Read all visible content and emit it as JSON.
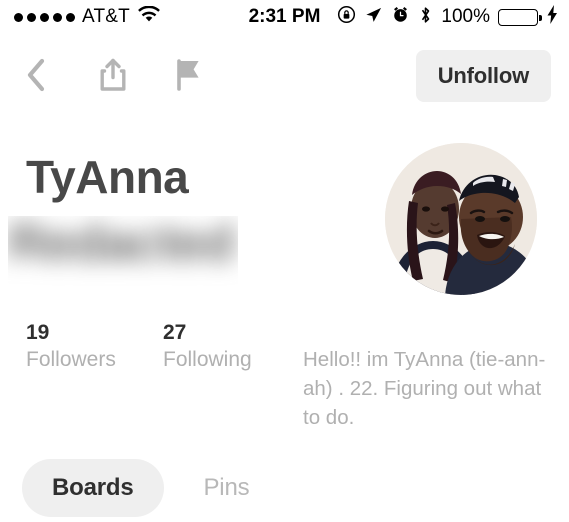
{
  "status_bar": {
    "signal_dots": 5,
    "carrier": "AT&T",
    "wifi_icon": "wifi-icon",
    "time": "2:31 PM",
    "rotation_lock_icon": "rotation-lock-icon",
    "location_icon": "location-arrow-icon",
    "alarm_icon": "alarm-clock-icon",
    "bluetooth_icon": "bluetooth-icon",
    "battery_percent": "100%",
    "battery_fill_color": "#4CD964",
    "charging_icon": "lightning-bolt-icon"
  },
  "navbar": {
    "back_icon": "back-chevron-icon",
    "share_icon": "share-icon",
    "flag_icon": "flag-icon",
    "unfollow_label": "Unfollow",
    "icon_color": "#b4b4b4",
    "button_bg": "#efefef"
  },
  "profile": {
    "name": "TyAnna",
    "last_name_redacted": "Redacted",
    "avatar_alt": "profile-photo-two-people",
    "bio": "Hello!! im TyAnna (tie-ann-ah) . 22. Figuring out what to do."
  },
  "stats": [
    {
      "count": "19",
      "label": "Followers"
    },
    {
      "count": "27",
      "label": "Following"
    }
  ],
  "tabs": [
    {
      "label": "Boards",
      "active": true
    },
    {
      "label": "Pins",
      "active": false
    }
  ]
}
